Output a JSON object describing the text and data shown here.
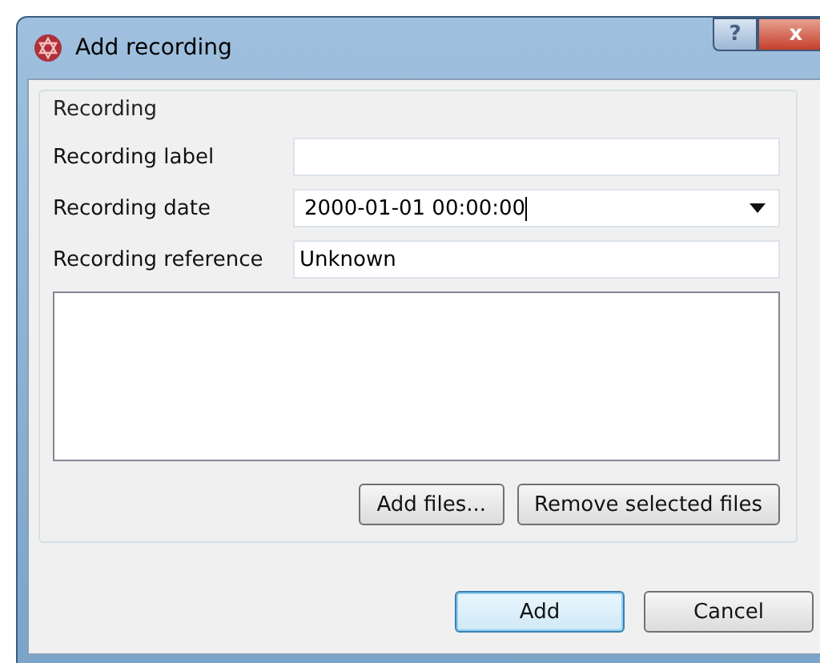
{
  "window": {
    "title": "Add recording",
    "help_button": "?",
    "close_button": "x"
  },
  "group": {
    "title": "Recording",
    "fields": [
      {
        "kind": "text",
        "label": "Recording label"
      },
      {
        "kind": "dropdown",
        "label": "Recording date",
        "value": "2000-01-01 00:00:00",
        "focused": true
      },
      {
        "kind": "text",
        "label": "Recording reference",
        "value": "Unknown"
      }
    ],
    "file_buttons": [
      "Add files...",
      "Remove selected files"
    ]
  },
  "buttons": [
    {
      "label": "Add",
      "default": true
    },
    {
      "label": "Cancel",
      "default": false
    }
  ]
}
